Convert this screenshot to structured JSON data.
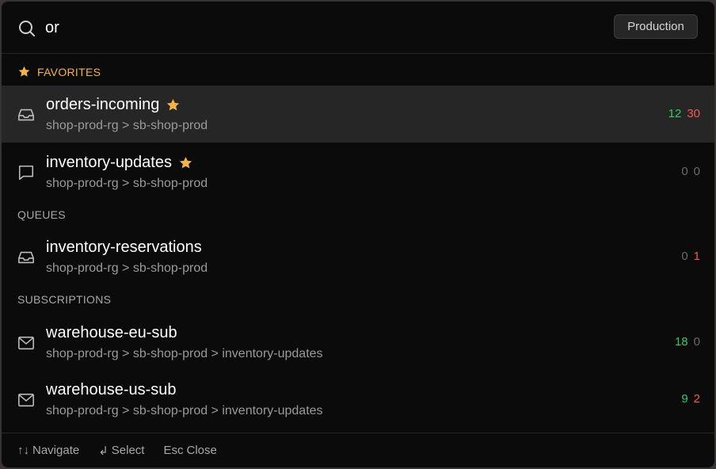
{
  "search": {
    "value": "or",
    "icon": "search-icon"
  },
  "environment_badge": "Production",
  "sections": {
    "favorites": "FAVORITES",
    "queues": "QUEUES",
    "subscriptions": "SUBSCRIPTIONS"
  },
  "items": [
    {
      "title": "orders-incoming",
      "path": "shop-prod-rg > sb-shop-prod",
      "icon": "inbox-icon",
      "favorite": true,
      "count_a": "12",
      "count_b": "30"
    },
    {
      "title": "inventory-updates",
      "path": "shop-prod-rg > sb-shop-prod",
      "icon": "message-icon",
      "favorite": true,
      "count_a": "0",
      "count_b": "0"
    },
    {
      "title": "inventory-reservations",
      "path": "shop-prod-rg > sb-shop-prod",
      "icon": "inbox-icon",
      "favorite": false,
      "count_a": "0",
      "count_b": "1"
    },
    {
      "title": "warehouse-eu-sub",
      "path": "shop-prod-rg > sb-shop-prod > inventory-updates",
      "icon": "mail-icon",
      "favorite": false,
      "count_a": "18",
      "count_b": "0"
    },
    {
      "title": "warehouse-us-sub",
      "path": "shop-prod-rg > sb-shop-prod > inventory-updates",
      "icon": "mail-icon",
      "favorite": false,
      "count_a": "9",
      "count_b": "2"
    }
  ],
  "footer": {
    "navigate_key": "↑↓",
    "navigate_label": "Navigate",
    "select_key": "↲",
    "select_label": "Select",
    "close_key": "Esc",
    "close_label": "Close"
  },
  "colors": {
    "accent_favorite": "#f5b342",
    "count_positive": "#34c76f",
    "count_dead": "#f05a5a",
    "count_zero": "#6a6a6a",
    "selected_row": "#262626"
  }
}
